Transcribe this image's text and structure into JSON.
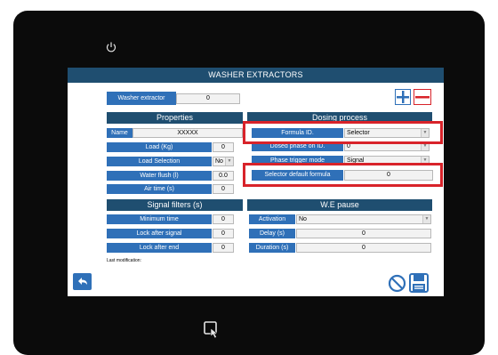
{
  "window": {
    "title": "WASHER EXTRACTORS"
  },
  "device": {
    "power_icon": "power-icon",
    "touch_icon": "touch-icon"
  },
  "washer": {
    "label": "Washer extractor",
    "value": "0"
  },
  "properties": {
    "title": "Properties",
    "name_label": "Name",
    "name_value": "XXXXX",
    "load_label": "Load (Kg)",
    "load_value": "0",
    "load_selection_label": "Load Selection",
    "load_selection_value": "No",
    "water_flush_label": "Water flush (l)",
    "water_flush_value": "0.0",
    "air_time_label": "Air time (s)",
    "air_time_value": "0"
  },
  "dosing": {
    "title": "Dosing process",
    "formula_label": "Formula ID.",
    "formula_value": "Selector",
    "dosed_phase_label": "Dosed phase on ID.",
    "dosed_phase_value": "0",
    "phase_trigger_label": "Phase trigger mode",
    "phase_trigger_value": "Signal",
    "selector_default_label": "Selector default formula",
    "selector_default_value": "0"
  },
  "signal_filters": {
    "title": "Signal filters (s)",
    "min_time_label": "Minimum time",
    "min_time_value": "0",
    "lock_after_signal_label": "Lock after signal",
    "lock_after_signal_value": "0",
    "lock_after_end_label": "Lock after end",
    "lock_after_end_value": "0"
  },
  "we_pause": {
    "title": "W.E pause",
    "activation_label": "Activation",
    "activation_value": "No",
    "delay_label": "Delay (s)",
    "delay_value": "0",
    "duration_label": "Duration (s)",
    "duration_value": "0"
  },
  "footer": {
    "last_modification": "Last modification:"
  },
  "colors": {
    "accent": "#2f70b8",
    "header": "#1f4e70",
    "highlight": "#d8232a"
  },
  "icons": [
    "plus-icon",
    "minus-icon",
    "back-arrow-icon",
    "cancel-icon",
    "save-icon"
  ]
}
